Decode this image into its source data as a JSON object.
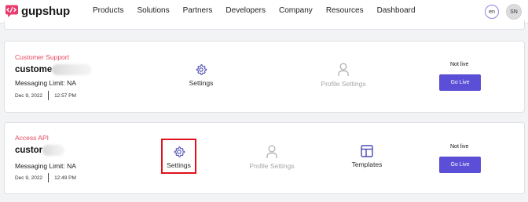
{
  "header": {
    "brand": "gupshup",
    "nav": [
      "Products",
      "Solutions",
      "Partners",
      "Developers",
      "Company",
      "Resources",
      "Dashboard"
    ],
    "lang": "en",
    "avatar_initials": "SN"
  },
  "apps": [
    {
      "type": "Customer Support",
      "name": "custome",
      "messaging_limit": "Messaging Limit: NA",
      "date": "Dec 9, 2022",
      "time": "12:57 PM",
      "settings_label": "Settings",
      "profile_settings_label": "Profile Settings",
      "status": "Not live",
      "go_live_label": "Go Live"
    },
    {
      "type": "Access API",
      "name": "custor",
      "messaging_limit": "Messaging Limit: NA",
      "date": "Dec 9, 2022",
      "time": "12:49 PM",
      "settings_label": "Settings",
      "profile_settings_label": "Profile Settings",
      "templates_label": "Templates",
      "status": "Not live",
      "go_live_label": "Go Live"
    }
  ],
  "colors": {
    "accent": "#5a4fd6",
    "type_label": "#e5475c",
    "highlight": "#e0111c",
    "icon": "#4a4ab5",
    "muted": "#a6a6a6"
  },
  "icons": {
    "logo": "gupshup-logo-icon",
    "settings": "gear-icon",
    "profile": "person-icon",
    "templates": "layout-template-icon"
  }
}
